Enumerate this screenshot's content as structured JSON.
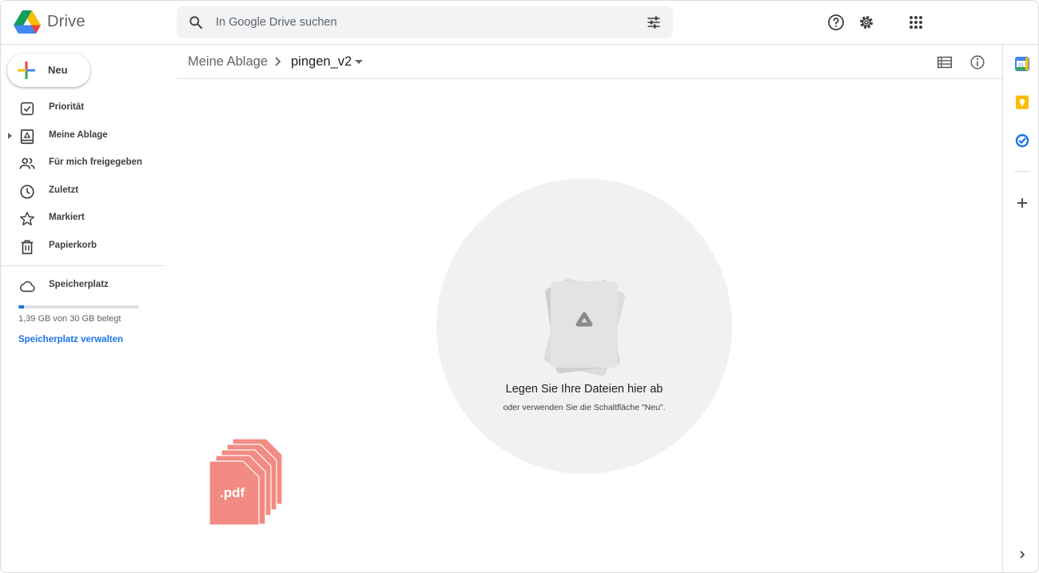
{
  "header": {
    "app_name": "Drive",
    "search_placeholder": "In Google Drive suchen",
    "icons": [
      "search-icon",
      "tune-icon",
      "help-icon",
      "settings-icon",
      "apps-grid-icon"
    ]
  },
  "sidebar": {
    "new_label": "Neu",
    "items": [
      {
        "label": "Priorität",
        "icon": "priority-icon"
      },
      {
        "label": "Meine Ablage",
        "icon": "my-drive-icon"
      },
      {
        "label": "Für mich freigegeben",
        "icon": "shared-icon"
      },
      {
        "label": "Zuletzt",
        "icon": "clock-icon"
      },
      {
        "label": "Markiert",
        "icon": "star-icon"
      },
      {
        "label": "Papierkorb",
        "icon": "trash-icon"
      }
    ],
    "storage": {
      "label": "Speicherplatz",
      "usage_text": "1,39 GB von 30 GB belegt",
      "used_fraction": 0.046,
      "manage_link": "Speicherplatz verwalten"
    }
  },
  "breadcrumb": {
    "root": "Meine Ablage",
    "current": "pingen_v2"
  },
  "main": {
    "drop_title": "Legen Sie Ihre Dateien hier ab",
    "drop_subtitle": "oder verwenden Sie die Schaltfläche \"Neu\".",
    "dragged_file_label": ".pdf"
  },
  "rail": {
    "calendar_day": "31",
    "icons": [
      "calendar-icon",
      "keep-icon",
      "tasks-icon",
      "add-icon",
      "expand-icon"
    ]
  },
  "colors": {
    "accent": "#1a73e8",
    "pdf": "#f28b82",
    "keep": "#fbbc04"
  }
}
